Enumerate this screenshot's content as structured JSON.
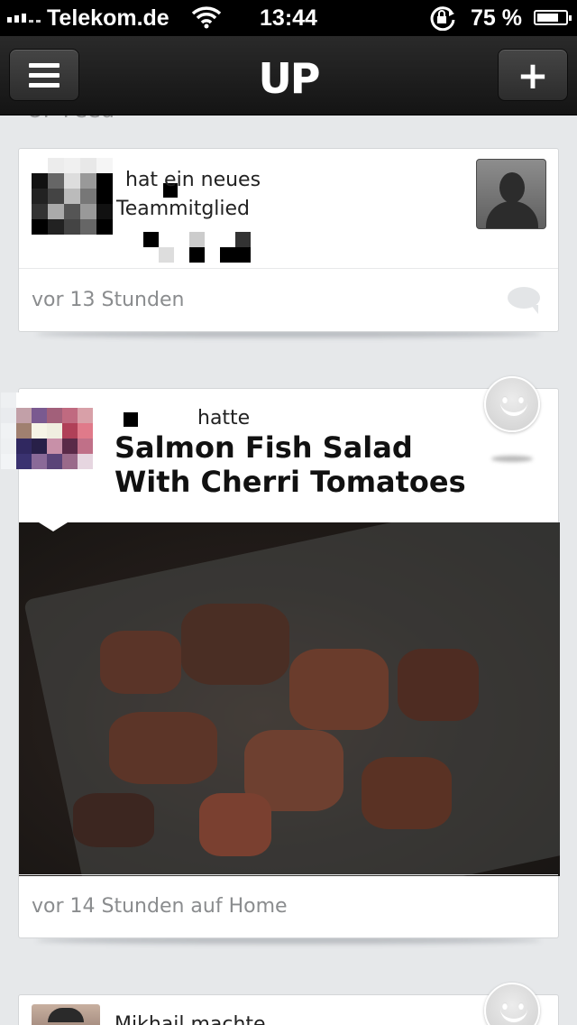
{
  "status_bar": {
    "carrier": "Telekom.de",
    "time": "13:44",
    "battery_percent_label": "75 %",
    "battery_level": 0.75,
    "icons": [
      "signal-icon",
      "wifi-icon",
      "rotation-lock-icon",
      "battery-icon"
    ]
  },
  "nav": {
    "logo": "UP",
    "menu_icon": "hamburger-menu-icon",
    "add_icon": "plus-icon",
    "add_label": "+"
  },
  "feed": {
    "heading": "UP Feed",
    "items": [
      {
        "text_line1": "hat ein neues",
        "text_line2": "Teammitglied",
        "timestamp": "vor 13 Stunden",
        "icon": "comment-icon"
      },
      {
        "verb": "hatte",
        "title_line1": "Salmon Fish Salad",
        "title_line2": "With Cherri Tomatoes",
        "timestamp": "vor 14 Stunden auf Home",
        "icon": "smiley-icon"
      },
      {
        "text": "Mikhail machte",
        "icon": "smiley-icon"
      }
    ]
  },
  "colors": {
    "background": "#e6e8ea",
    "navbar": "#1c1c1c",
    "card": "#ffffff",
    "muted_text": "#8a8c8e"
  }
}
